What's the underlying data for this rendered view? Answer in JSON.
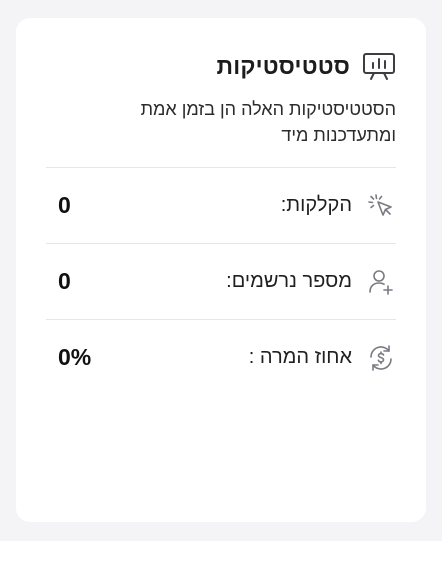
{
  "card": {
    "title": "סטטיסטיקות",
    "title_icon": "presentation-chart-icon",
    "description": "הסטטיסטיקות האלה הן בזמן אמת ומתעדכנות מיד"
  },
  "stats": [
    {
      "label": "הקלקות:",
      "value": "0",
      "icon": "cursor-click-icon"
    },
    {
      "label": "מספר נרשמים:",
      "value": "0",
      "icon": "user-add-icon"
    },
    {
      "label": "אחוז המרה :",
      "value": "0%",
      "icon": "currency-refresh-icon"
    }
  ],
  "colors": {
    "background": "#f4f4f6",
    "card": "#ffffff",
    "icon_stroke": "#7a7a82",
    "divider": "#e6e6e8"
  }
}
